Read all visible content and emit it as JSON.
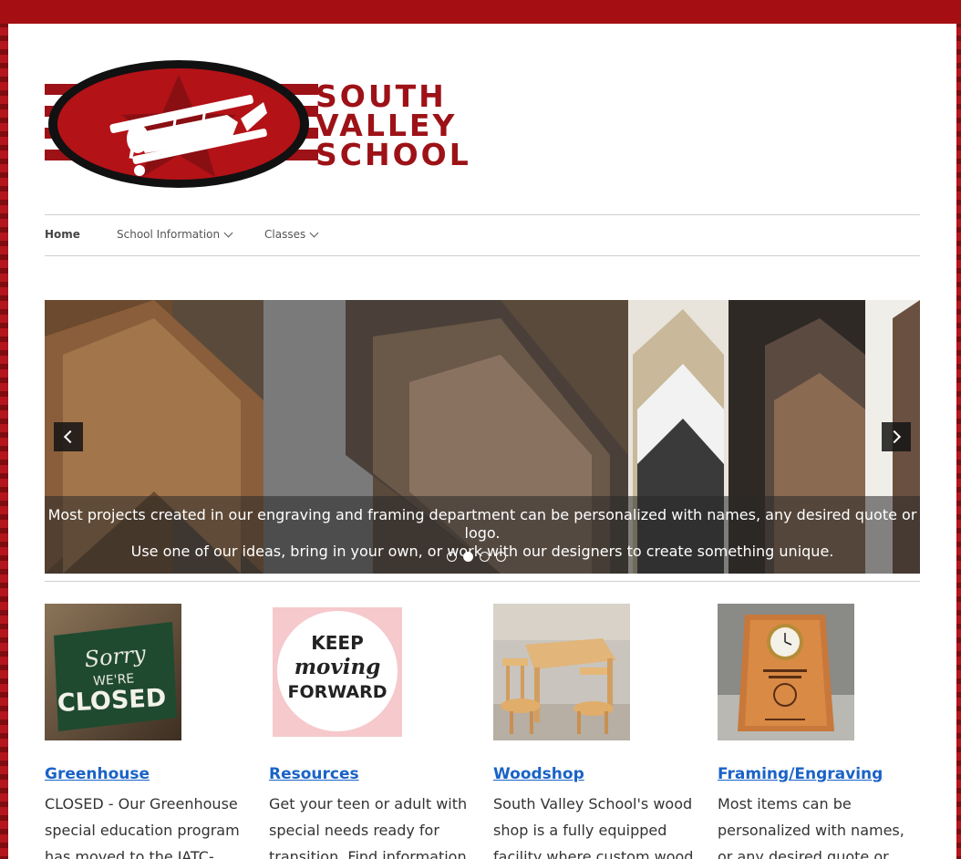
{
  "site": {
    "logo_lines": [
      "SOUTH",
      "VALLEY",
      "SCHOOL"
    ]
  },
  "nav": {
    "items": [
      {
        "label": "Home"
      },
      {
        "label": "School Information"
      },
      {
        "label": "Classes"
      }
    ]
  },
  "slider": {
    "caption_line1": "Most projects created in our engraving and framing department can be personalized with names, any desired quote or logo.",
    "caption_line2": "Use one of our ideas, bring in your own, or work with our designers to create something unique.",
    "slide_count": 4,
    "active_slide": 2
  },
  "thumb_text": {
    "sorry": "Sorry",
    "were": "WE'RE",
    "closed": "CLOSED",
    "keep": "KEEP",
    "moving": "moving",
    "forward": "FORWARD"
  },
  "features": [
    {
      "title": "Greenhouse",
      "text": "CLOSED - Our Greenhouse special education program has moved to the JATC-South"
    },
    {
      "title": "Resources",
      "text": "Get your teen or adult with special needs ready for transition.  Find information"
    },
    {
      "title": "Woodshop",
      "text": "South Valley School's wood shop is a fully equipped facility where custom wood"
    },
    {
      "title": "Framing/Engraving",
      "text": "Most items can be personalized with names, or any desired quote or logo."
    }
  ]
}
